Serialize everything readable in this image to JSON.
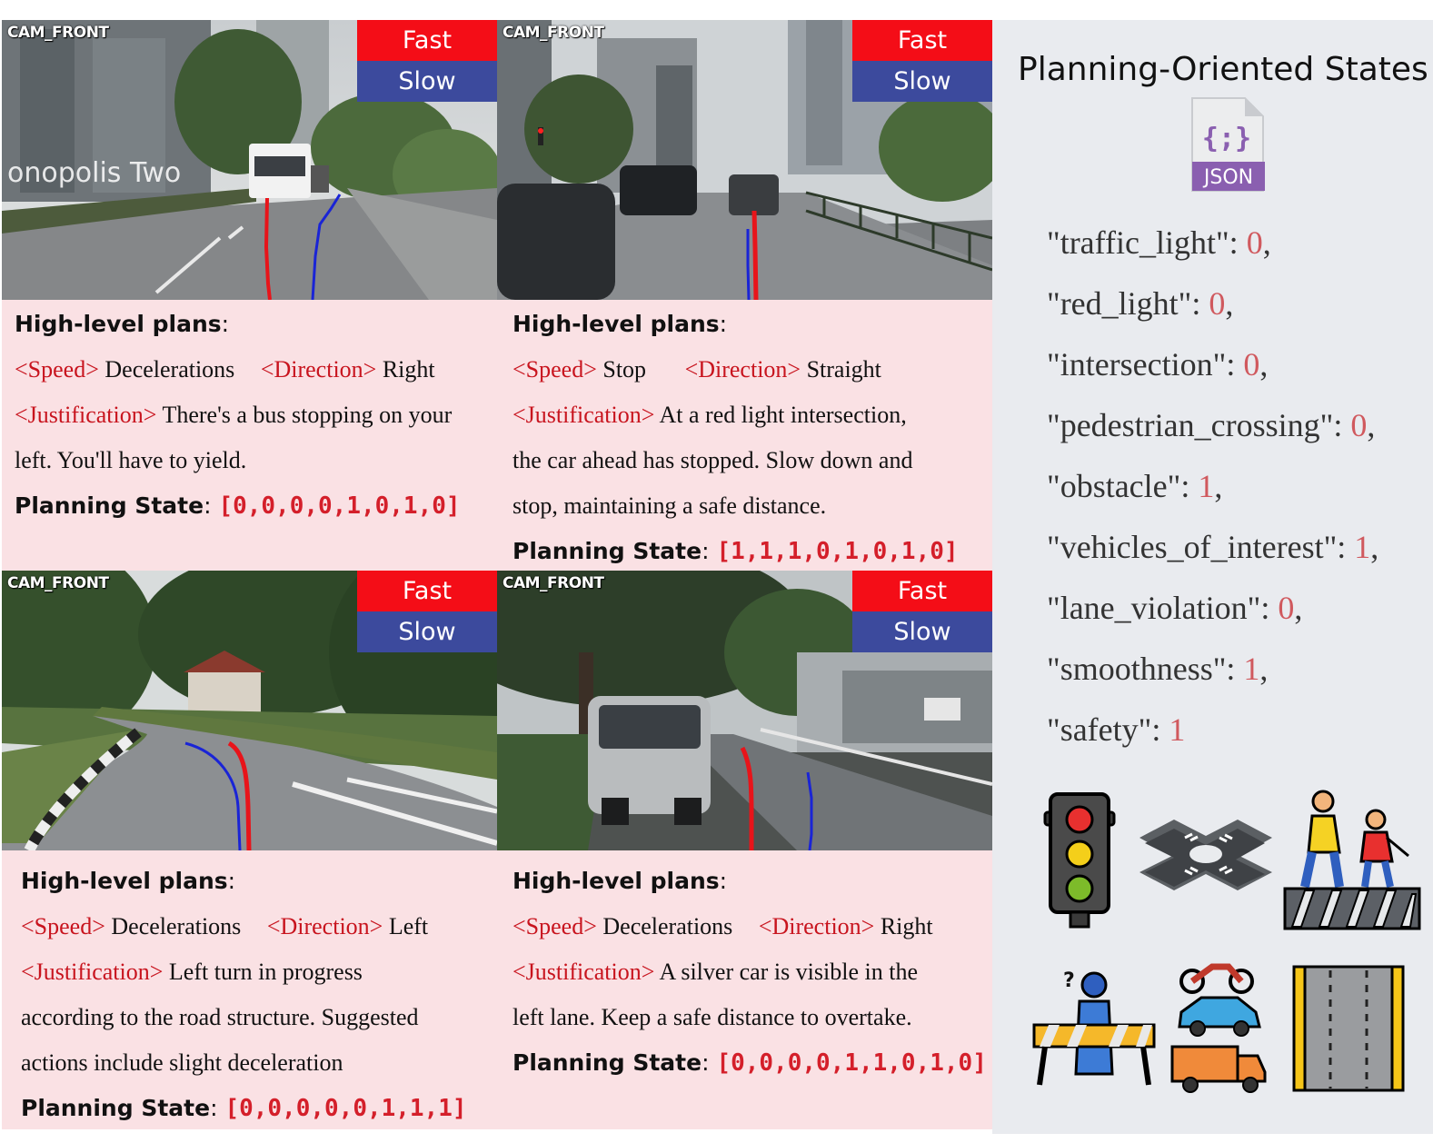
{
  "legend": {
    "fast": "Fast",
    "slow": "Slow"
  },
  "camera_label": "CAM_FRONT",
  "panels": [
    {
      "heading": "High-level plans",
      "speed_tag": "<Speed>",
      "speed": "Decelerations",
      "direction_tag": "<Direction>",
      "direction": "Right",
      "justification_tag": "<Justification>",
      "justification_lines": [
        "There's a bus stopping on your",
        "left. You'll have to yield."
      ],
      "planning_label": "Planning State",
      "planning_state": "[0,0,0,0,1,0,1,0]",
      "scene_sign_text": "onopolis Two"
    },
    {
      "heading": "High-level plans",
      "speed_tag": "<Speed>",
      "speed": "Stop",
      "direction_tag": "<Direction>",
      "direction": "Straight",
      "justification_tag": "<Justification>",
      "justification_lines": [
        "At a red light intersection,",
        "the car ahead has stopped. Slow down and",
        "stop, maintaining a safe distance."
      ],
      "planning_label": "Planning State",
      "planning_state": "[1,1,1,0,1,0,1,0]"
    },
    {
      "heading": "High-level plans",
      "speed_tag": "<Speed>",
      "speed": "Decelerations",
      "direction_tag": "<Direction>",
      "direction": "Left",
      "justification_tag": "<Justification>",
      "justification_lines": [
        "Left turn in progress",
        "according to the road structure. Suggested",
        "actions include slight deceleration"
      ],
      "planning_label": "Planning State",
      "planning_state": "[0,0,0,0,0,1,1,1]"
    },
    {
      "heading": "High-level plans",
      "speed_tag": "<Speed>",
      "speed": "Decelerations",
      "direction_tag": "<Direction>",
      "direction": "Right",
      "justification_tag": "<Justification>",
      "justification_lines": [
        "A silver car is visible in the",
        "left lane. Keep a safe distance to overtake."
      ],
      "planning_label": "Planning State",
      "planning_state": "[0,0,0,0,1,1,0,1,0]"
    }
  ],
  "states_panel": {
    "title": "Planning-Oriented States",
    "json_badge": "JSON",
    "json_glyph": "{;}",
    "states": [
      {
        "key": "\"traffic_light\": ",
        "value": "0",
        "sep": ","
      },
      {
        "key": "\"red_light\": ",
        "value": "0",
        "sep": ","
      },
      {
        "key": "\"intersection\": ",
        "value": "0",
        "sep": ","
      },
      {
        "key": "\"pedestrian_crossing\": ",
        "value": "0",
        "sep": ","
      },
      {
        "key": "\"obstacle\": ",
        "value": "1",
        "sep": ","
      },
      {
        "key": "\"vehicles_of_interest\": ",
        "value": "1",
        "sep": ","
      },
      {
        "key": "\"lane_violation\": ",
        "value": "0",
        "sep": ","
      },
      {
        "key": "\"smoothness\": ",
        "value": "1",
        "sep": ","
      },
      {
        "key": "\"safety\": ",
        "value": "1",
        "sep": ""
      }
    ],
    "icons": [
      "traffic-light-icon",
      "intersection-icon",
      "pedestrian-crossing-icon",
      "obstacle-icon",
      "vehicles-icon",
      "lane-icon"
    ],
    "colors": {
      "value": "#d0595e",
      "bg": "#e9ebef"
    }
  },
  "colors": {
    "fast": "#f40d17",
    "slow": "#3c4a9d",
    "panel_bg": "#fae1e4",
    "tag_red": "#c8141e"
  }
}
